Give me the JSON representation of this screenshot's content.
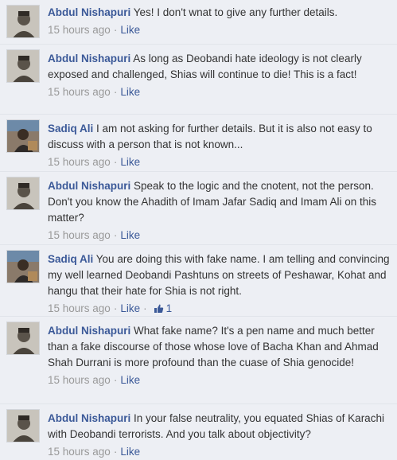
{
  "comments": [
    {
      "author": "Abdul Nishapuri",
      "text": "Yes! I don't wnat to give any further details.",
      "time": "15 hours ago",
      "like_label": "Like",
      "like_count": ""
    },
    {
      "author": "Abdul Nishapuri",
      "text": "As long as Deobandi hate ideology is not clearly exposed and challenged, Shias will continue to die! This is a fact!",
      "time": "15 hours ago",
      "like_label": "Like",
      "like_count": ""
    },
    {
      "author": "Sadiq Ali",
      "text": "I am not asking for further details. But it is also not easy to discuss with a person that is not known...",
      "time": "15 hours ago",
      "like_label": "Like",
      "like_count": ""
    },
    {
      "author": "Abdul Nishapuri",
      "text": "Speak to the logic and the cnotent, not the person. Don't you know the Ahadith of Imam Jafar Sadiq and Imam Ali on this matter?",
      "time": "15 hours ago",
      "like_label": "Like",
      "like_count": ""
    },
    {
      "author": "Sadiq Ali",
      "text": "You are doing this with fake name. I am telling and convincing my well learned Deobandi Pashtuns on streets of Peshawar, Kohat and hangu that their hate for Shia is not right.",
      "time": "15 hours ago",
      "like_label": "Like",
      "like_count": "1"
    },
    {
      "author": "Abdul Nishapuri",
      "text": "What fake name? It's a pen name and much better than a fake discourse of those whose love of Bacha Khan and Ahmad Shah Durrani is more profound than the cuase of Shia genocide!",
      "time": "15 hours ago",
      "like_label": "Like",
      "like_count": ""
    },
    {
      "author": "Abdul Nishapuri",
      "text": "In your false neutrality, you equated Shias of Karachi with Deobandi terrorists. And you talk about objectivity?",
      "time": "15 hours ago",
      "like_label": "Like",
      "like_count": ""
    }
  ],
  "separator": "·",
  "colors": {
    "background": "#edeff4",
    "author_link": "#3b5998",
    "meta_text": "#999999",
    "body_text": "#333333"
  }
}
